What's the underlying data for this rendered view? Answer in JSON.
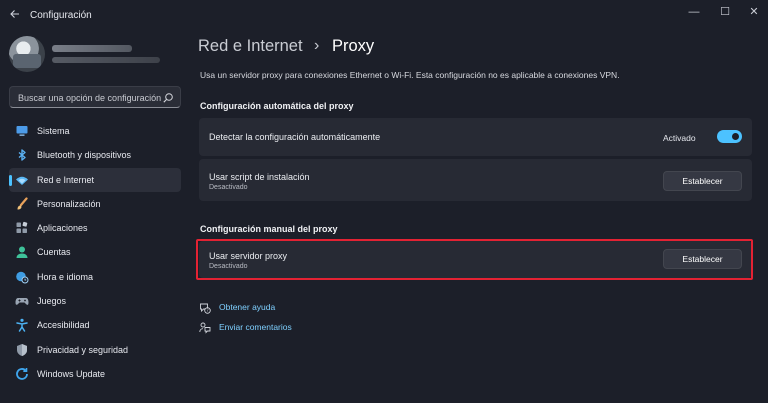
{
  "window": {
    "title": "Configuración",
    "controls": {
      "minimize": "—",
      "maximize": "☐",
      "close": "✕"
    }
  },
  "sidebar": {
    "search": {
      "placeholder": "Buscar una opción de configuración",
      "icon": "search-icon"
    },
    "items": [
      {
        "label": "Sistema",
        "icon": "monitor-icon",
        "active": false
      },
      {
        "label": "Bluetooth y dispositivos",
        "icon": "bluetooth-icon",
        "active": false
      },
      {
        "label": "Red e Internet",
        "icon": "wifi-icon",
        "active": true
      },
      {
        "label": "Personalización",
        "icon": "brush-icon",
        "active": false
      },
      {
        "label": "Aplicaciones",
        "icon": "apps-icon",
        "active": false
      },
      {
        "label": "Cuentas",
        "icon": "person-icon",
        "active": false
      },
      {
        "label": "Hora e idioma",
        "icon": "globe-clock-icon",
        "active": false
      },
      {
        "label": "Juegos",
        "icon": "gamepad-icon",
        "active": false
      },
      {
        "label": "Accesibilidad",
        "icon": "accessibility-icon",
        "active": false
      },
      {
        "label": "Privacidad y seguridad",
        "icon": "shield-icon",
        "active": false
      },
      {
        "label": "Windows Update",
        "icon": "update-icon",
        "active": false
      }
    ]
  },
  "header": {
    "breadcrumb_parent": "Red e Internet",
    "breadcrumb_separator": "›",
    "breadcrumb_current": "Proxy",
    "description": "Usa un servidor proxy para conexiones Ethernet o Wi-Fi. Esta configuración no es aplicable a conexiones VPN."
  },
  "auto_section": {
    "title": "Configuración automática del proxy",
    "detect": {
      "label": "Detectar la configuración automáticamente",
      "state": "Activado",
      "on": true
    },
    "script": {
      "label": "Usar script de instalación",
      "status": "Desactivado",
      "button": "Establecer"
    }
  },
  "manual_section": {
    "title": "Configuración manual del proxy",
    "proxy": {
      "label": "Usar servidor proxy",
      "status": "Desactivado",
      "button": "Establecer"
    }
  },
  "links": {
    "help": "Obtener ayuda",
    "feedback": "Enviar comentarios"
  },
  "colors": {
    "accent": "#4cc2ff",
    "highlight": "#e32233",
    "background": "#1c1f29",
    "card": "#272a34"
  }
}
